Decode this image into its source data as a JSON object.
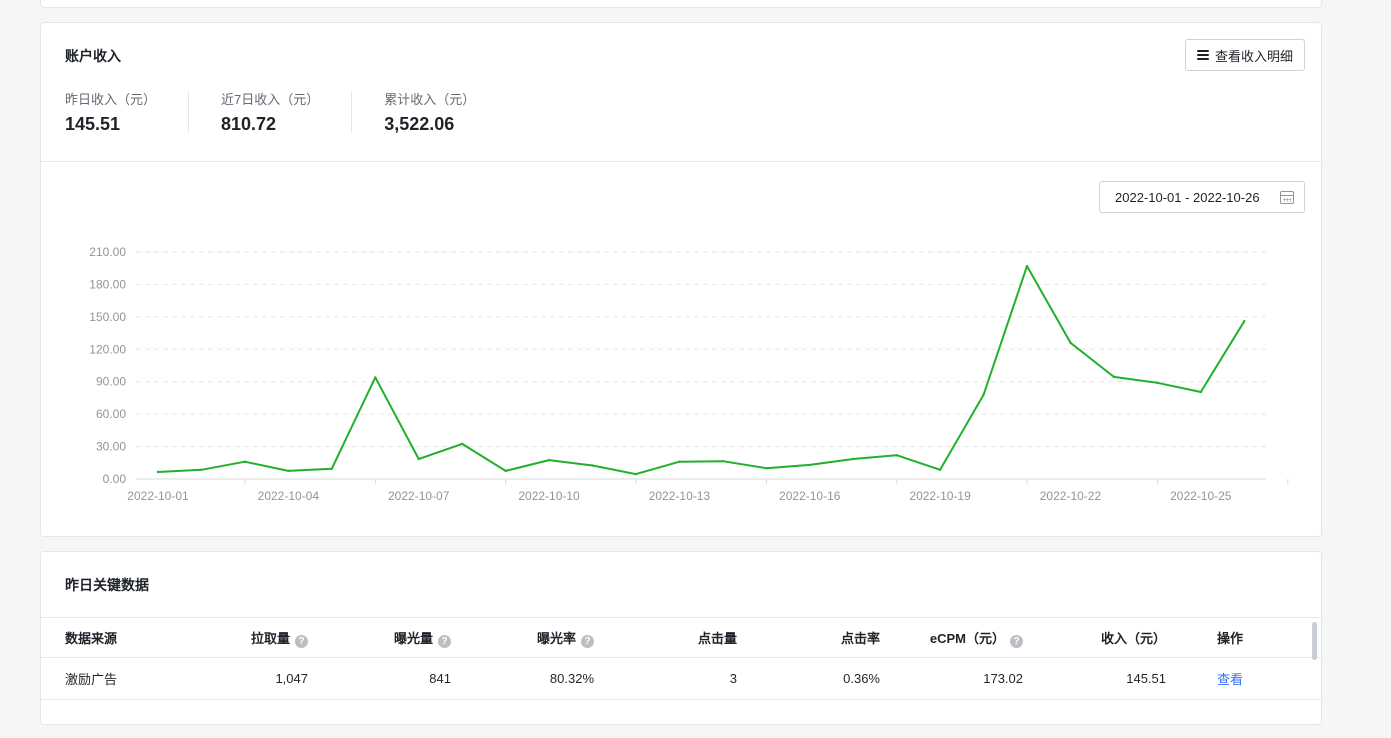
{
  "income": {
    "title": "账户收入",
    "detail_button": "查看收入明细",
    "stats": [
      {
        "label": "昨日收入（元）",
        "value": "145.51"
      },
      {
        "label": "近7日收入（元）",
        "value": "810.72"
      },
      {
        "label": "累计收入（元）",
        "value": "3,522.06"
      }
    ],
    "date_range": "2022-10-01 - 2022-10-26",
    "colors": {
      "line": "#22b02c"
    }
  },
  "chart_data": {
    "type": "line",
    "x": [
      "2022-10-01",
      "2022-10-02",
      "2022-10-03",
      "2022-10-04",
      "2022-10-05",
      "2022-10-06",
      "2022-10-07",
      "2022-10-08",
      "2022-10-09",
      "2022-10-10",
      "2022-10-11",
      "2022-10-12",
      "2022-10-13",
      "2022-10-14",
      "2022-10-15",
      "2022-10-16",
      "2022-10-17",
      "2022-10-18",
      "2022-10-19",
      "2022-10-20",
      "2022-10-21",
      "2022-10-22",
      "2022-10-23",
      "2022-10-24",
      "2022-10-25",
      "2022-10-26"
    ],
    "x_tick_labels": [
      "2022-10-01",
      "2022-10-04",
      "2022-10-07",
      "2022-10-10",
      "2022-10-13",
      "2022-10-16",
      "2022-10-19",
      "2022-10-22",
      "2022-10-25"
    ],
    "series": [
      {
        "values": [
          6.5,
          8.5,
          16,
          7.5,
          9.5,
          94,
          18.5,
          32.5,
          7.5,
          17.5,
          12.5,
          4.5,
          16,
          16.5,
          10,
          13,
          18.5,
          22,
          8.5,
          78,
          197,
          126,
          94.5,
          89,
          80.5,
          146
        ]
      }
    ],
    "y_tick_labels": [
      "0.00",
      "30.00",
      "60.00",
      "90.00",
      "120.00",
      "150.00",
      "180.00",
      "210.00"
    ],
    "ylim": [
      0,
      210
    ],
    "grid": true
  },
  "keydata": {
    "title": "昨日关键数据",
    "columns": [
      "数据来源",
      "拉取量",
      "曝光量",
      "曝光率",
      "点击量",
      "点击率",
      "eCPM（元）",
      "收入（元）",
      "操作"
    ],
    "rows": [
      [
        "激励广告",
        "1,047",
        "841",
        "80.32%",
        "3",
        "0.36%",
        "173.02",
        "145.51",
        "查看"
      ]
    ]
  }
}
